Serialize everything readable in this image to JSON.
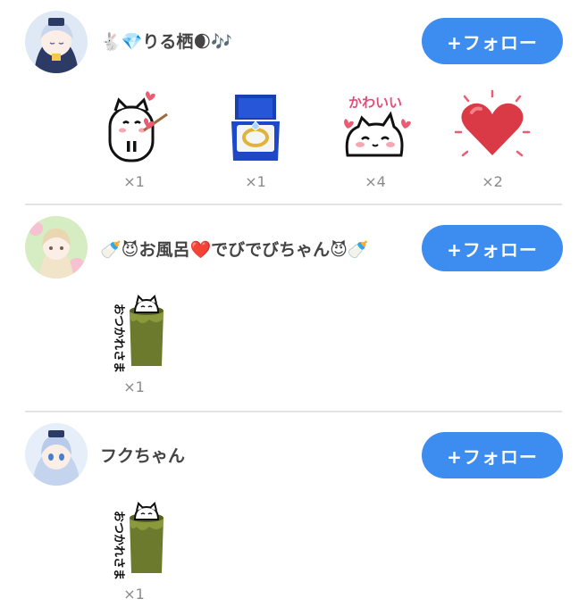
{
  "entries": [
    {
      "username": "🐇💎りる栖🌒🎶",
      "follow_label": "+フォロー",
      "gifts": [
        {
          "icon": "cat-arrow-heart-icon",
          "count": "×1"
        },
        {
          "icon": "ring-box-icon",
          "count": "×1"
        },
        {
          "icon": "kawaii-cat-icon",
          "count": "×4"
        },
        {
          "icon": "heart-icon",
          "count": "×2"
        }
      ]
    },
    {
      "username": "🍼😈お風呂❤️でびでびちゃん😈🍼",
      "follow_label": "+フォロー",
      "gifts": [
        {
          "icon": "otsukaresama-cat-icon",
          "count": "×1"
        }
      ]
    },
    {
      "username": "フクちゃん",
      "follow_label": "+フォロー",
      "gifts": [
        {
          "icon": "otsukaresama-cat-icon",
          "count": "×1"
        }
      ]
    }
  ],
  "sticker_text": {
    "kawaii": "かわいい",
    "otsukare": "おつかれさま"
  },
  "colors": {
    "follow_button": "#3d8cf0",
    "count_text": "#8a8a8a",
    "divider": "#e3e3e3"
  }
}
